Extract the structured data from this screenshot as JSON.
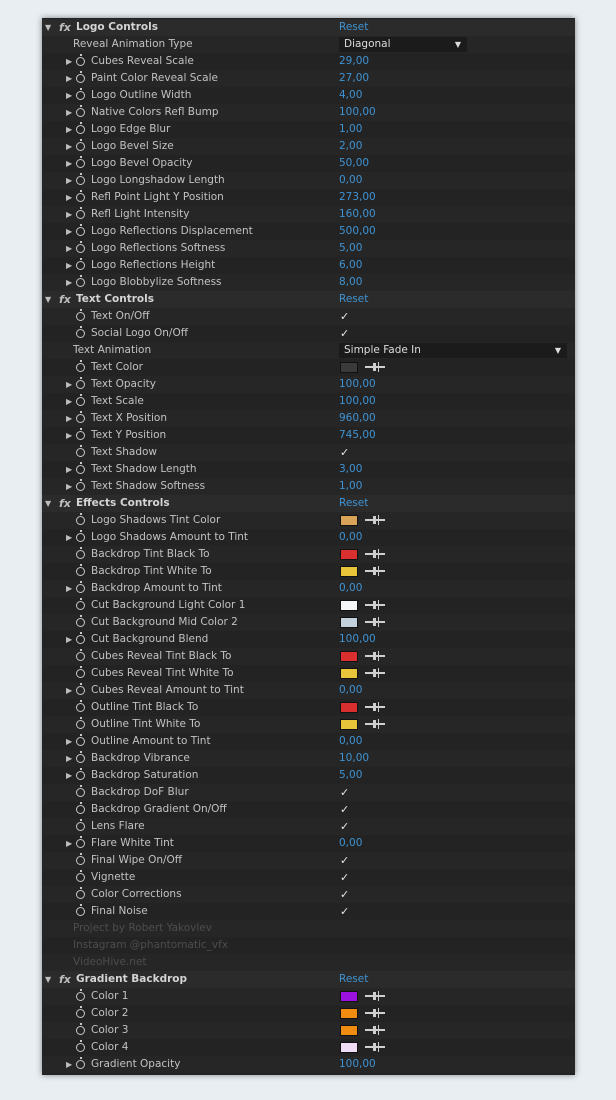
{
  "rows": [
    {
      "kind": "header",
      "label": "Logo Controls",
      "reset": "Reset"
    },
    {
      "kind": "dropdown",
      "label": "Reveal Animation Type",
      "value": "Diagonal",
      "width": "short"
    },
    {
      "kind": "num",
      "label": "Cubes Reveal Scale",
      "value": "29,00"
    },
    {
      "kind": "num",
      "label": "Paint Color Reveal Scale",
      "value": "27,00"
    },
    {
      "kind": "num",
      "label": "Logo Outline Width",
      "value": "4,00"
    },
    {
      "kind": "num",
      "label": "Native Colors Refl Bump",
      "value": "100,00"
    },
    {
      "kind": "num",
      "label": "Logo Edge Blur",
      "value": "1,00"
    },
    {
      "kind": "num",
      "label": "Logo Bevel Size",
      "value": "2,00"
    },
    {
      "kind": "num",
      "label": "Logo Bevel Opacity",
      "value": "50,00"
    },
    {
      "kind": "num",
      "label": "Logo Longshadow Length",
      "value": "0,00"
    },
    {
      "kind": "num",
      "label": "Refl Point Light Y Position",
      "value": "273,00"
    },
    {
      "kind": "num",
      "label": "Refl Light Intensity",
      "value": "160,00"
    },
    {
      "kind": "num",
      "label": "Logo Reflections Displacement",
      "value": "500,00"
    },
    {
      "kind": "num",
      "label": "Logo Reflections Softness",
      "value": "5,00"
    },
    {
      "kind": "num",
      "label": "Logo Reflections Height",
      "value": "6,00"
    },
    {
      "kind": "num",
      "label": "Logo Blobbylize Softness",
      "value": "8,00"
    },
    {
      "kind": "header",
      "label": "Text Controls",
      "reset": "Reset"
    },
    {
      "kind": "check",
      "label": "Text On/Off"
    },
    {
      "kind": "check",
      "label": "Social Logo On/Off"
    },
    {
      "kind": "dropdown",
      "label": "Text Animation",
      "value": "Simple Fade In",
      "width": "long"
    },
    {
      "kind": "color",
      "label": "Text Color",
      "color": "#3a3a3a"
    },
    {
      "kind": "num",
      "label": "Text Opacity",
      "value": "100,00"
    },
    {
      "kind": "num",
      "label": "Text Scale",
      "value": "100,00"
    },
    {
      "kind": "num",
      "label": "Text X Position",
      "value": "960,00"
    },
    {
      "kind": "num",
      "label": "Text Y Position",
      "value": "745,00"
    },
    {
      "kind": "check",
      "label": "Text Shadow"
    },
    {
      "kind": "num",
      "label": "Text Shadow Length",
      "value": "3,00"
    },
    {
      "kind": "num",
      "label": "Text Shadow Softness",
      "value": "1,00"
    },
    {
      "kind": "header",
      "label": "Effects Controls",
      "reset": "Reset"
    },
    {
      "kind": "color",
      "label": "Logo Shadows Tint Color",
      "color": "#d9a35a"
    },
    {
      "kind": "num",
      "label": "Logo Shadows Amount to Tint",
      "value": "0,00"
    },
    {
      "kind": "color",
      "label": "Backdrop Tint Black To",
      "color": "#d92f2f"
    },
    {
      "kind": "color",
      "label": "Backdrop Tint White To",
      "color": "#e8c43a"
    },
    {
      "kind": "num",
      "label": "Backdrop Amount to Tint",
      "value": "0,00"
    },
    {
      "kind": "color",
      "label": "Cut Background Light Color 1",
      "color": "#f4f6f8"
    },
    {
      "kind": "color",
      "label": "Cut Background Mid Color 2",
      "color": "#c3d1dc"
    },
    {
      "kind": "num",
      "label": "Cut Background Blend",
      "value": "100,00"
    },
    {
      "kind": "color",
      "label": "Cubes Reveal Tint Black To",
      "color": "#d92f2f"
    },
    {
      "kind": "color",
      "label": "Cubes Reveal Tint White To",
      "color": "#e8c43a"
    },
    {
      "kind": "num",
      "label": "Cubes Reveal Amount to Tint",
      "value": "0,00"
    },
    {
      "kind": "color",
      "label": "Outline Tint Black To",
      "color": "#d92f2f"
    },
    {
      "kind": "color",
      "label": "Outline Tint White To",
      "color": "#e8c43a"
    },
    {
      "kind": "num",
      "label": "Outline Amount to Tint",
      "value": "0,00"
    },
    {
      "kind": "num",
      "label": "Backdrop Vibrance",
      "value": "10,00"
    },
    {
      "kind": "num",
      "label": "Backdrop Saturation",
      "value": "5,00"
    },
    {
      "kind": "check",
      "label": "Backdrop DoF Blur"
    },
    {
      "kind": "check",
      "label": "Backdrop Gradient On/Off"
    },
    {
      "kind": "check",
      "label": "Lens Flare"
    },
    {
      "kind": "num",
      "label": "Flare White Tint",
      "value": "0,00"
    },
    {
      "kind": "check",
      "label": "Final Wipe On/Off"
    },
    {
      "kind": "check",
      "label": "Vignette"
    },
    {
      "kind": "check",
      "label": "Color Corrections"
    },
    {
      "kind": "check",
      "label": "Final Noise"
    },
    {
      "kind": "note",
      "label": "Project by Robert Yakovlev"
    },
    {
      "kind": "note",
      "label": "Instagram @phantomatic_vfx"
    },
    {
      "kind": "note",
      "label": "VideoHive.net"
    },
    {
      "kind": "header",
      "label": "Gradient Backdrop",
      "reset": "Reset"
    },
    {
      "kind": "color",
      "label": "Color 1",
      "color": "#9b11e0"
    },
    {
      "kind": "color",
      "label": "Color 2",
      "color": "#f08c10"
    },
    {
      "kind": "color",
      "label": "Color 3",
      "color": "#f08c10"
    },
    {
      "kind": "color",
      "label": "Color 4",
      "color": "#f0dcf4"
    },
    {
      "kind": "num",
      "label": "Gradient Opacity",
      "value": "100,00"
    }
  ],
  "check_glyph": "✓",
  "fx_glyph": "fx",
  "open_arrow": "▼",
  "closed_arrow": "▶"
}
